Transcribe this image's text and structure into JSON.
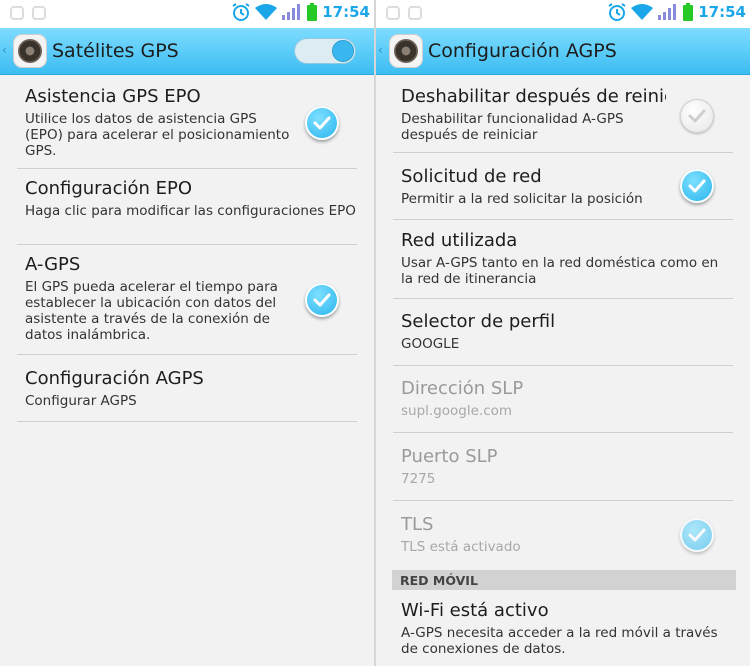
{
  "status_bar": {
    "time": "17:54"
  },
  "left": {
    "title": "Satélites GPS",
    "items": [
      {
        "title": "Asistencia GPS EPO",
        "summary": "Utilice los datos de asistencia GPS (EPO) para acelerar el posicionamiento GPS."
      },
      {
        "title": "Configuración EPO",
        "summary": "Haga clic para modificar las configuraciones EPO"
      },
      {
        "title": "A-GPS",
        "summary": "El GPS pueda acelerar el tiempo para establecer la ubicación con datos del asistente a través de la conexión de datos inalámbrica."
      },
      {
        "title": "Configuración AGPS",
        "summary": "Configurar AGPS"
      }
    ]
  },
  "right": {
    "title": "Configuración AGPS",
    "items": [
      {
        "title": "Deshabilitar después de reinicia",
        "summary": "Deshabilitar funcionalidad A-GPS después de reiniciar"
      },
      {
        "title": "Solicitud de red",
        "summary": "Permitir a la red solicitar la posición"
      },
      {
        "title": "Red utilizada",
        "summary": "Usar A-GPS tanto en la red doméstica como en la red de itinerancia"
      },
      {
        "title": "Selector de perfil",
        "summary": "GOOGLE"
      },
      {
        "title": "Dirección SLP",
        "summary": "supl.google.com"
      },
      {
        "title": "Puerto SLP",
        "summary": "7275"
      },
      {
        "title": "TLS",
        "summary": "TLS está activado"
      }
    ],
    "category": "RED MÓVIL",
    "wifi": {
      "title": "Wi-Fi está activo",
      "summary": "A-GPS necesita acceder a la red móvil a través de conexiones de datos."
    }
  },
  "checkboxes": {
    "left_epo_assist": true,
    "left_agps": true,
    "right_disable_after_reboot": false,
    "right_network_request": true,
    "right_tls": true
  },
  "toggle_on": true,
  "accent_color": "#33b5e5"
}
